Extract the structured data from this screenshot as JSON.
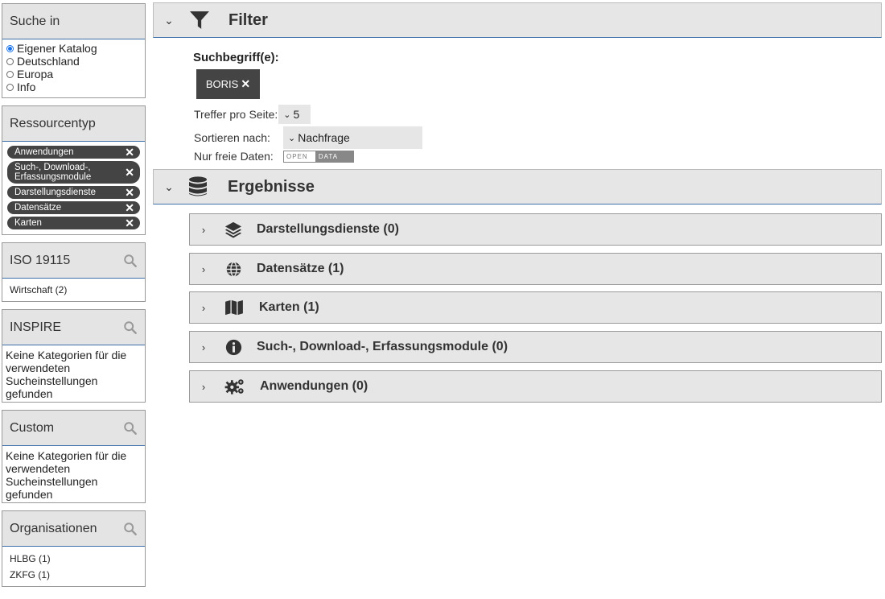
{
  "sidebar": {
    "suche_in": {
      "title": "Suche in",
      "options": [
        {
          "label": "Eigener Katalog",
          "selected": true
        },
        {
          "label": "Deutschland",
          "selected": false
        },
        {
          "label": "Europa",
          "selected": false
        },
        {
          "label": "Info",
          "selected": false
        }
      ]
    },
    "ressourcentyp": {
      "title": "Ressourcentyp",
      "tags": [
        "Anwendungen",
        "Such-, Download-, Erfassungsmodule",
        "Darstellungsdienste",
        "Datensätze",
        "Karten"
      ]
    },
    "iso": {
      "title": "ISO 19115",
      "items": [
        "Wirtschaft (2)"
      ]
    },
    "inspire": {
      "title": "INSPIRE",
      "empty": "Keine Kategorien für die verwendeten Sucheinstellungen gefunden"
    },
    "custom": {
      "title": "Custom",
      "empty": "Keine Kategorien für die verwendeten Sucheinstellungen gefunden"
    },
    "organisationen": {
      "title": "Organisationen",
      "items": [
        "HLBG (1)",
        "ZKFG (1)"
      ]
    }
  },
  "filter": {
    "title": "Filter",
    "search_terms_label": "Suchbegriff(e):",
    "term": "BORIS",
    "per_page_label": "Treffer pro Seite:",
    "per_page_value": "5",
    "sort_label": "Sortieren nach:",
    "sort_value": "Nachfrage",
    "free_label": "Nur freie Daten:",
    "open_text": "OPEN",
    "data_text": "DATA"
  },
  "results": {
    "title": "Ergebnisse",
    "items": [
      {
        "label": "Darstellungsdienste (0)",
        "icon": "layers-icon"
      },
      {
        "label": "Datensätze (1)",
        "icon": "globe-icon"
      },
      {
        "label": "Karten (1)",
        "icon": "map-icon"
      },
      {
        "label": "Such-, Download-, Erfassungsmodule (0)",
        "icon": "info-icon"
      },
      {
        "label": "Anwendungen (0)",
        "icon": "gears-icon"
      }
    ]
  }
}
